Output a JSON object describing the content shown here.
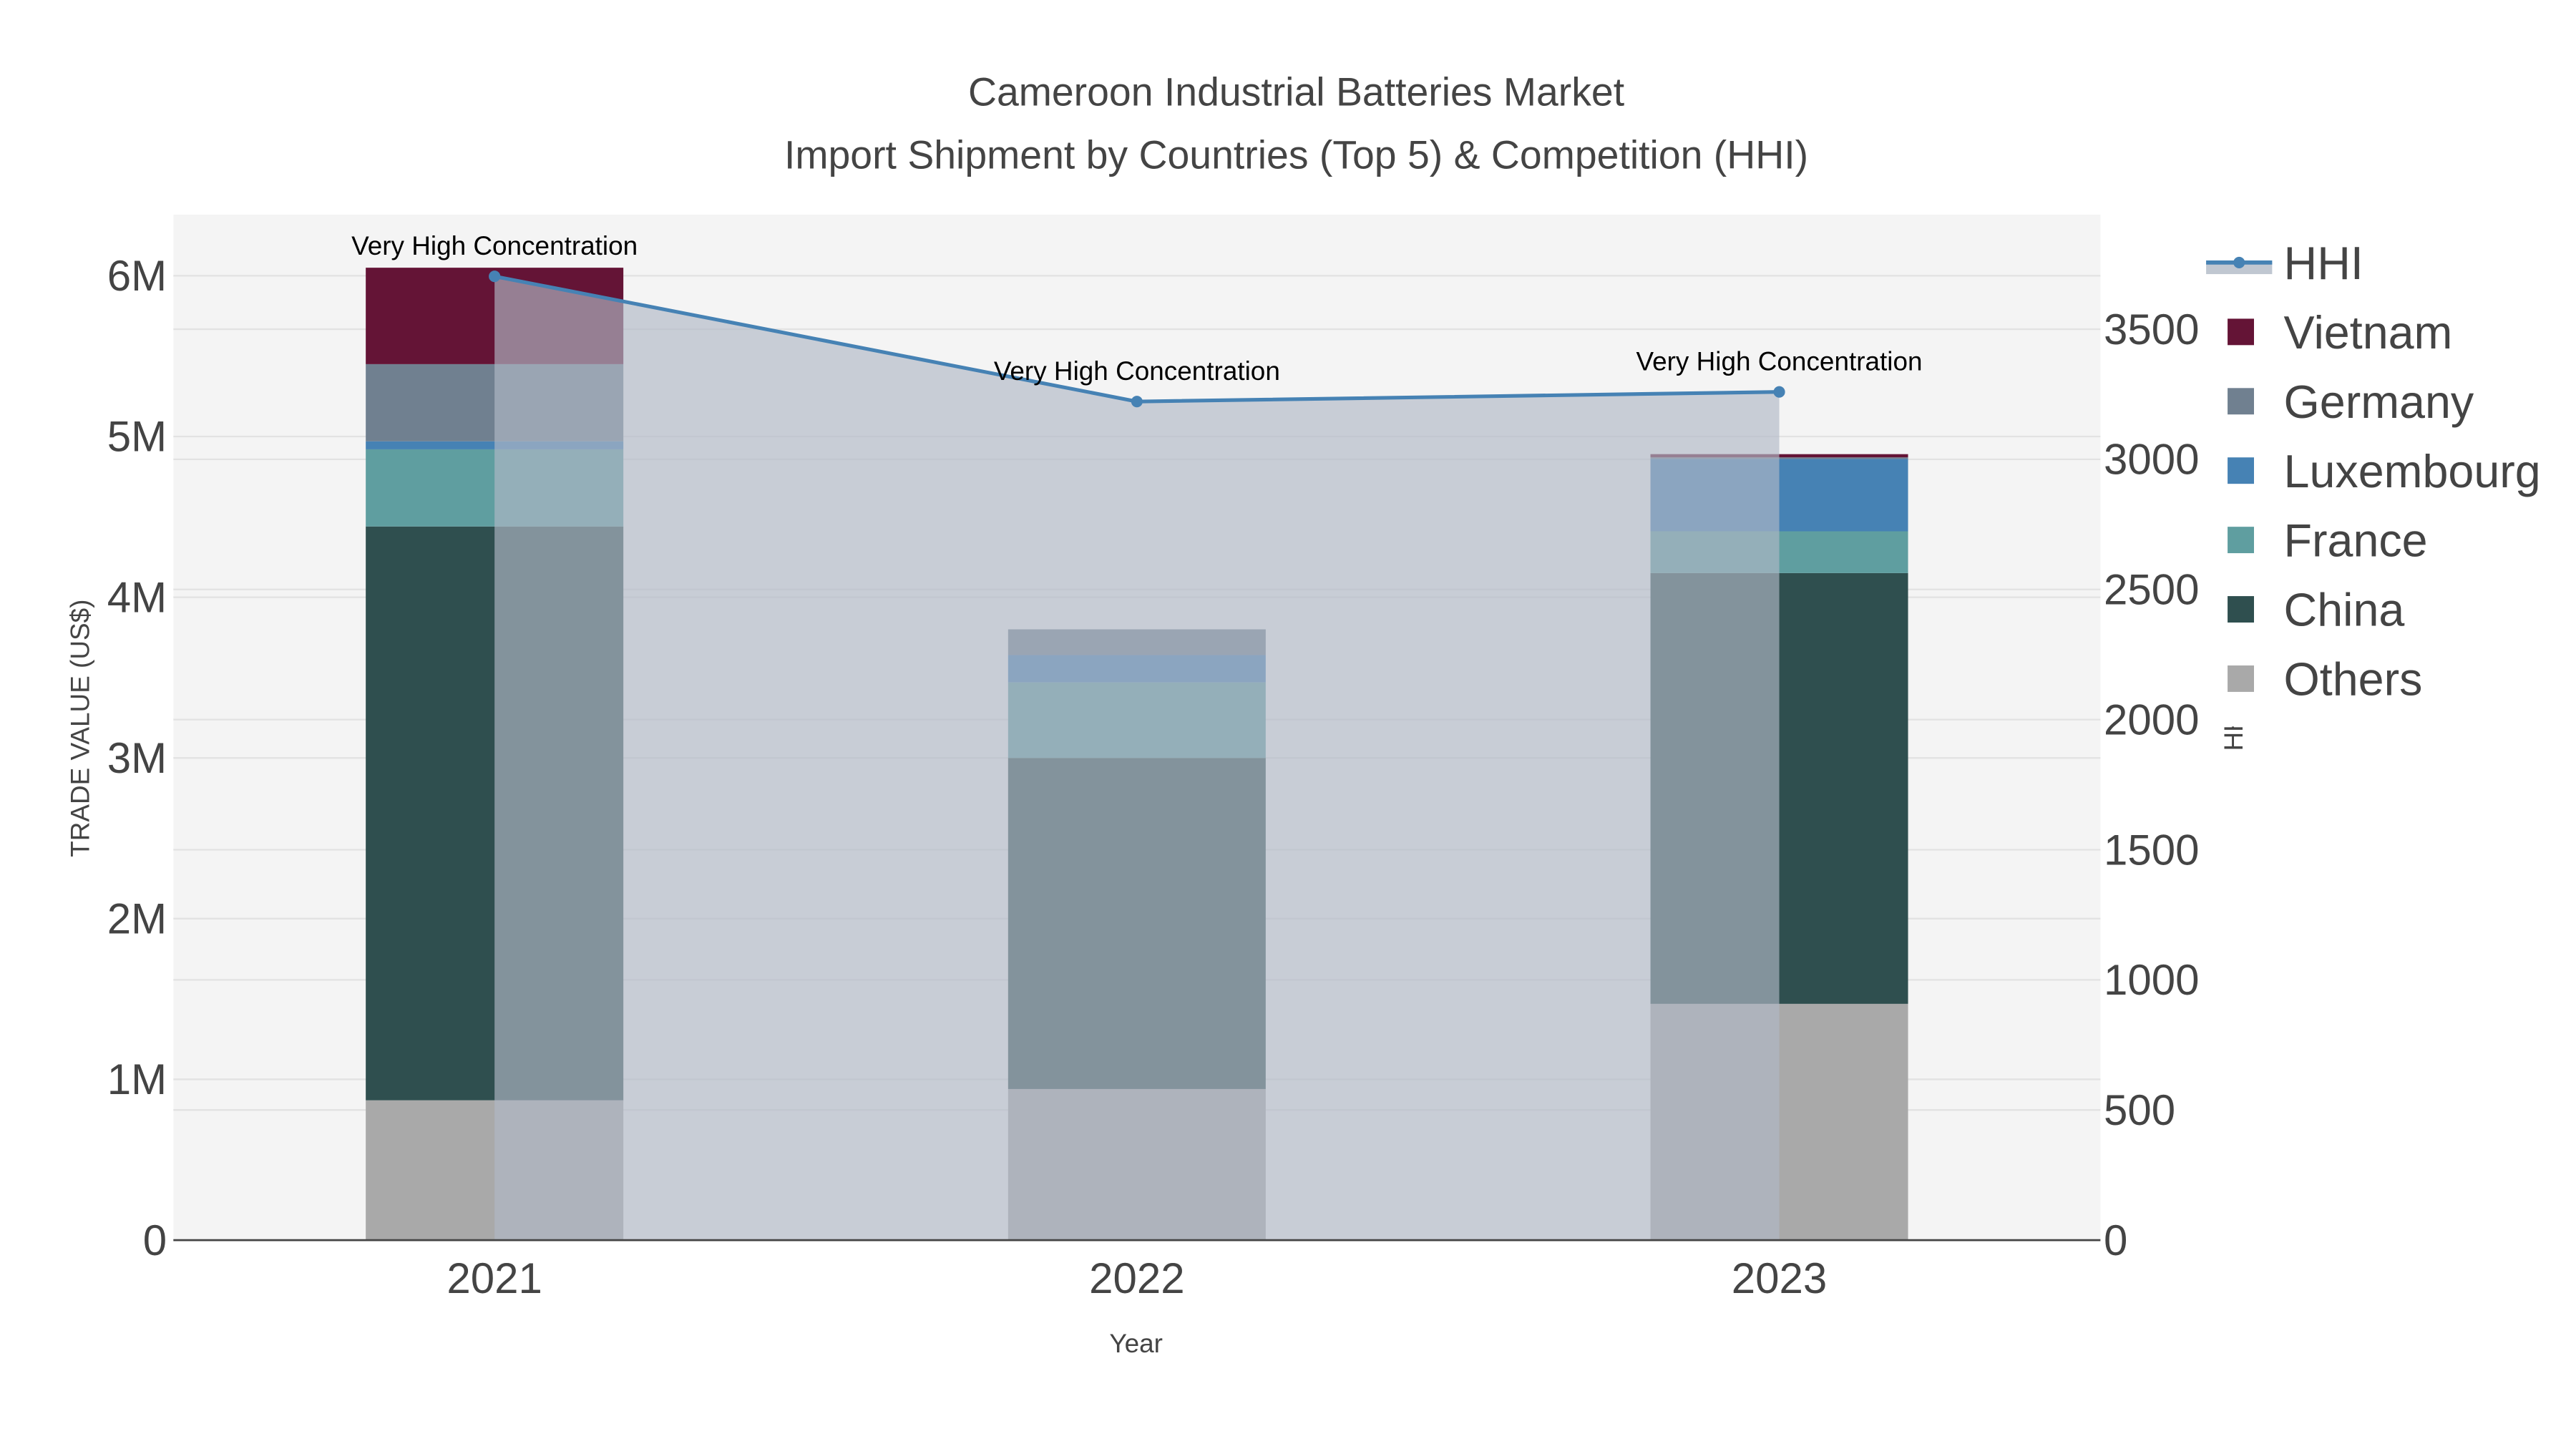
{
  "chart_data": {
    "type": "bar",
    "stacked": true,
    "title": "Cameroon Industrial Batteries Market",
    "subtitle": "Import Shipment by Countries (Top 5) & Competition (HHI)",
    "xlabel": "Year",
    "ylabel": "TRADE VALUE (US$)",
    "y2label": "HHI",
    "categories": [
      "2021",
      "2022",
      "2023"
    ],
    "ylim": [
      0,
      6380000
    ],
    "y2lim": [
      0,
      3940
    ],
    "yticks": [
      0,
      1000000,
      2000000,
      3000000,
      4000000,
      5000000,
      6000000
    ],
    "ytick_labels": [
      "0",
      "1M",
      "2M",
      "3M",
      "4M",
      "5M",
      "6M"
    ],
    "y2ticks": [
      0,
      500,
      1000,
      1500,
      2000,
      2500,
      3000,
      3500
    ],
    "y2tick_labels": [
      "0",
      "500",
      "1000",
      "1500",
      "2000",
      "2500",
      "3000",
      "3500"
    ],
    "grid": true,
    "legend_placement": "right",
    "series": [
      {
        "name": "Others",
        "color": "#A9A9A9",
        "values": [
          870000,
          940000,
          1470000
        ]
      },
      {
        "name": "China",
        "color": "#2F4F4F",
        "values": [
          3570000,
          2060000,
          2680000
        ]
      },
      {
        "name": "France",
        "color": "#5F9EA0",
        "values": [
          480000,
          470000,
          260000
        ]
      },
      {
        "name": "Luxembourg",
        "color": "#4682B4",
        "values": [
          50000,
          170000,
          450000
        ]
      },
      {
        "name": "Germany",
        "color": "#708090",
        "values": [
          480000,
          160000,
          10000
        ]
      },
      {
        "name": "Vietnam",
        "color": "#641436",
        "values": [
          600000,
          0,
          20000
        ]
      }
    ],
    "hhi": {
      "name": "HHI",
      "color": "#4682B4",
      "values": [
        3703,
        3222,
        3259
      ],
      "annotations": [
        "Very High Concentration",
        "Very High Concentration",
        "Very High Concentration"
      ]
    },
    "legend_order": [
      "HHI",
      "Vietnam",
      "Germany",
      "Luxembourg",
      "France",
      "China",
      "Others"
    ]
  }
}
